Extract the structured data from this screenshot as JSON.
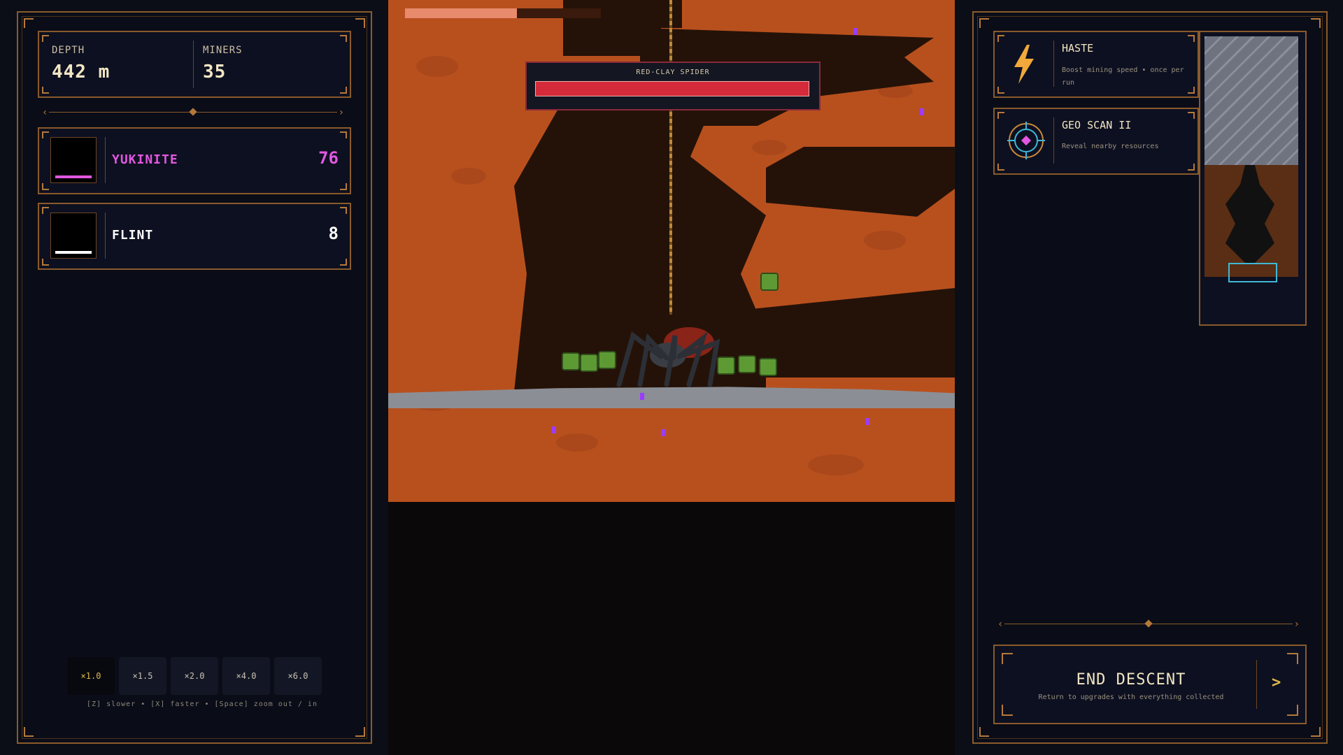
{
  "stats": {
    "depth_label": "DEPTH",
    "depth_value": "442 m",
    "miners_label": "MINERS",
    "miners_value": "35"
  },
  "resources": [
    {
      "name": "YUKINITE",
      "count": "76",
      "color": "#e257e0"
    },
    {
      "name": "FLINT",
      "count": "8",
      "color": "#ffffff"
    }
  ],
  "speed": {
    "options": [
      "×1.0",
      "×1.5",
      "×2.0",
      "×4.0",
      "×6.0"
    ],
    "active": "×1.0",
    "hint": "[Z] slower  •  [X] faster  •  [Space] zoom out / in"
  },
  "boss": {
    "name": "RED-CLAY SPIDER",
    "health_fraction": 1.0,
    "color": "#d42a3a"
  },
  "descent_progress": {
    "fraction": 0.57
  },
  "upgrades": [
    {
      "title": "HASTE",
      "desc": "Boost mining speed • once per run",
      "icon": "lightning-icon"
    },
    {
      "title": "GEO SCAN II",
      "desc": "Reveal nearby resources",
      "icon": "radar-scan-icon"
    }
  ],
  "end_descent": {
    "title": "END DESCENT",
    "subtitle": "Return to upgrades with everything collected",
    "arrow": ">"
  },
  "colors": {
    "frame": "#8a5a2b",
    "accent_gold": "#e0b84a",
    "dirt": "#b8501e",
    "tunnel": "#241208",
    "rock_band": "#8c8e95",
    "minimap_frame": "#3fb8d8"
  }
}
